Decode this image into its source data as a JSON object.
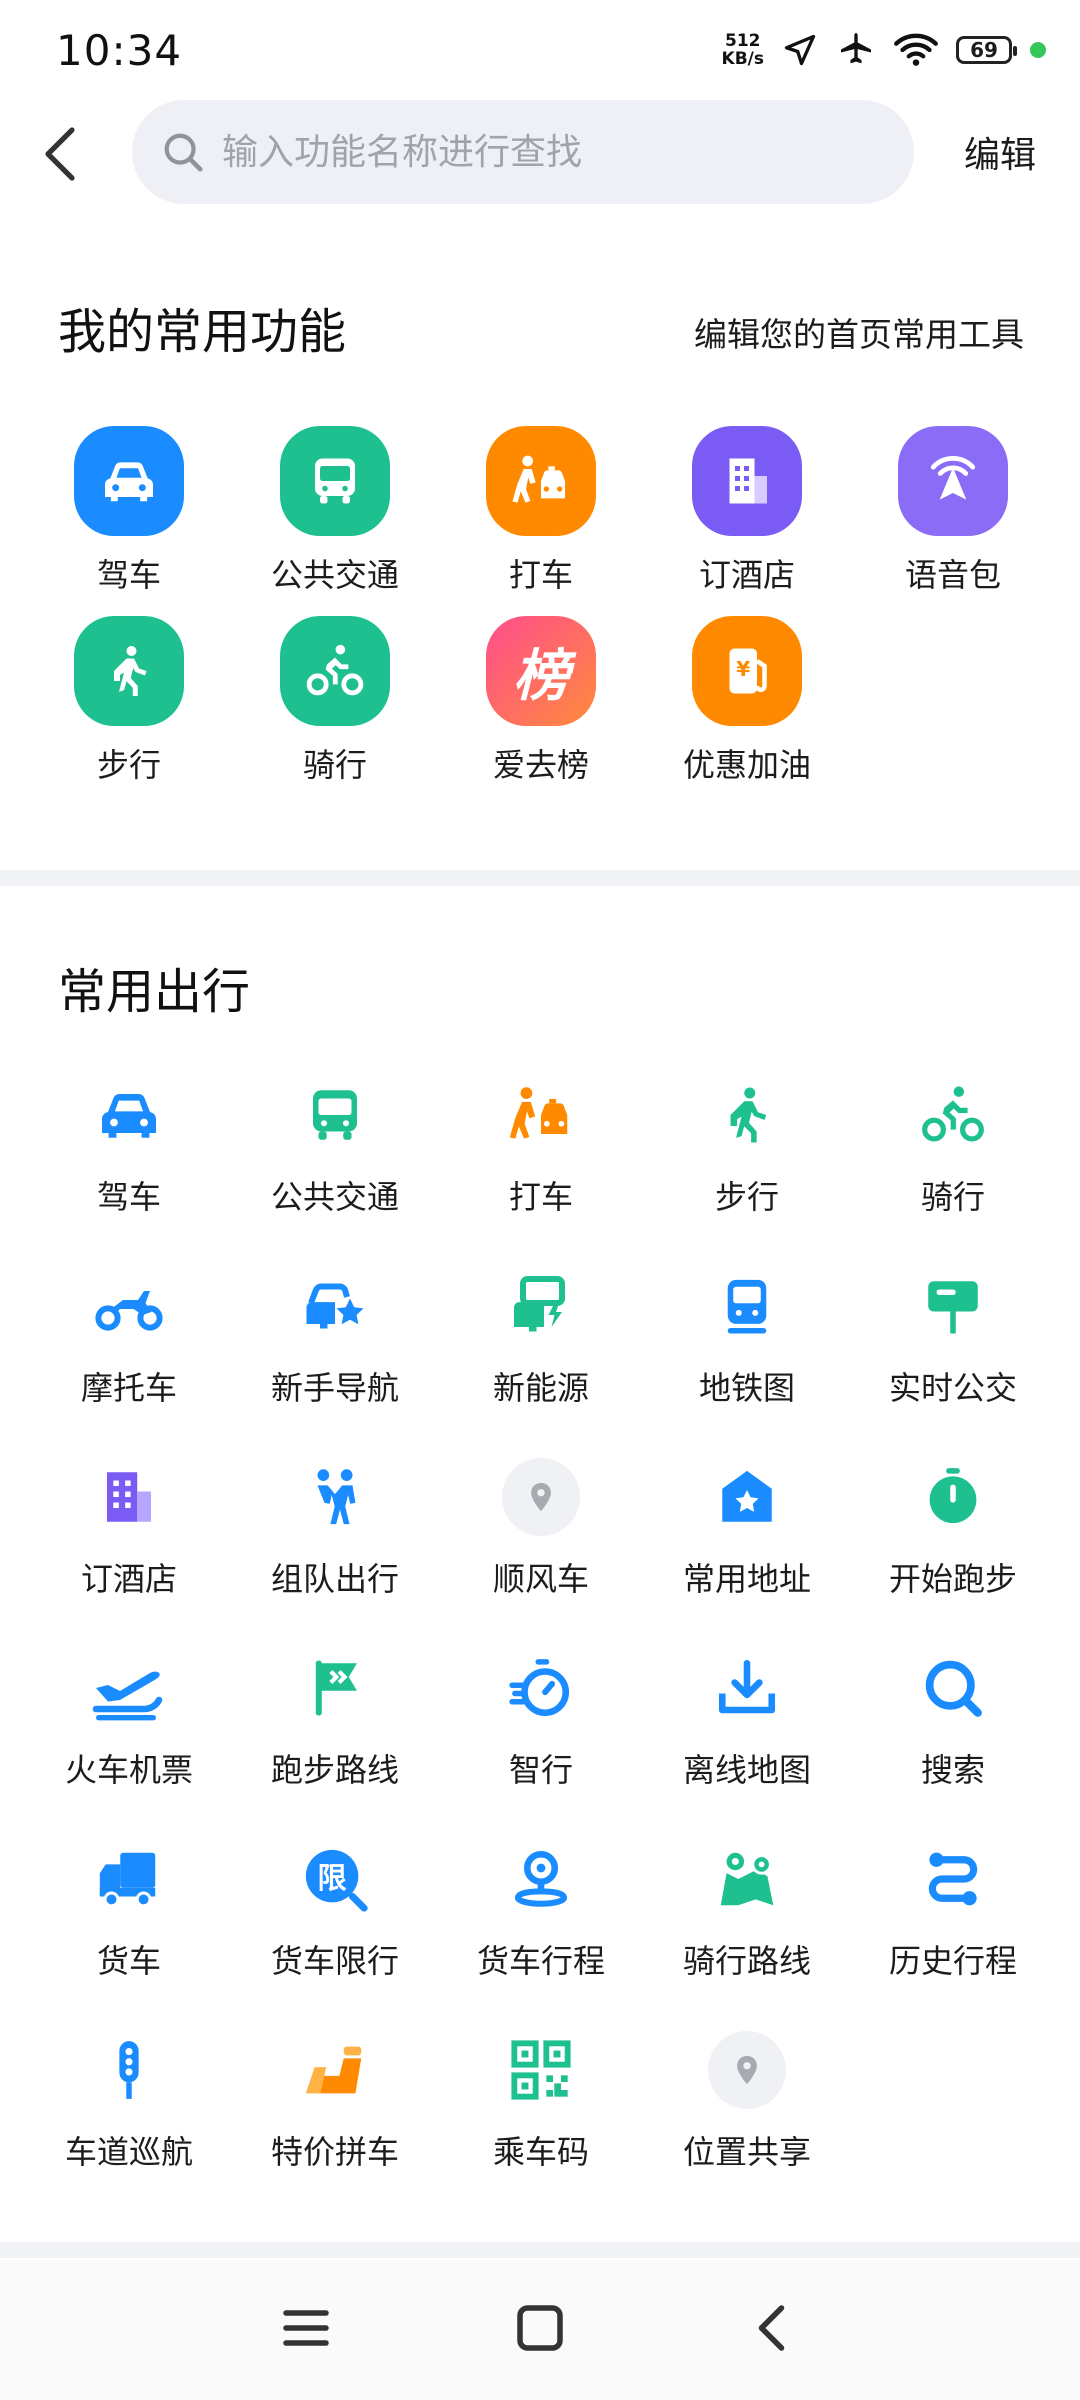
{
  "status": {
    "time": "10:34",
    "net_speed_value": "512",
    "net_speed_unit": "KB/s",
    "battery": "69"
  },
  "header": {
    "search_placeholder": "输入功能名称进行查找",
    "edit": "编辑"
  },
  "favorites": {
    "title": "我的常用功能",
    "subtitle": "编辑您的首页常用工具",
    "items": [
      {
        "label": "驾车",
        "icon": "car-icon",
        "color": "#1a8cff"
      },
      {
        "label": "公共交通",
        "icon": "bus-icon",
        "color": "#1fc08f"
      },
      {
        "label": "打车",
        "icon": "taxi-icon",
        "color": "#ff8a00"
      },
      {
        "label": "订酒店",
        "icon": "hotel-icon",
        "color": "#7a5cf5"
      },
      {
        "label": "语音包",
        "icon": "voice-pack-icon",
        "color": "#8a6cf7"
      },
      {
        "label": "步行",
        "icon": "walk-icon",
        "color": "#1fc08f"
      },
      {
        "label": "骑行",
        "icon": "bike-icon",
        "color": "#1fc08f"
      },
      {
        "label": "爱去榜",
        "icon": "ranking-icon",
        "color": "#ff5a7a"
      },
      {
        "label": "优惠加油",
        "icon": "fuel-icon",
        "color": "#ff8a00"
      }
    ]
  },
  "travel": {
    "title": "常用出行",
    "items": [
      {
        "label": "驾车",
        "icon": "car-icon"
      },
      {
        "label": "公共交通",
        "icon": "bus-icon"
      },
      {
        "label": "打车",
        "icon": "taxi-icon"
      },
      {
        "label": "步行",
        "icon": "walk-icon"
      },
      {
        "label": "骑行",
        "icon": "bike-icon"
      },
      {
        "label": "摩托车",
        "icon": "motorcycle-icon"
      },
      {
        "label": "新手导航",
        "icon": "novice-nav-icon"
      },
      {
        "label": "新能源",
        "icon": "ev-icon"
      },
      {
        "label": "地铁图",
        "icon": "subway-icon"
      },
      {
        "label": "实时公交",
        "icon": "realtime-bus-icon"
      },
      {
        "label": "订酒店",
        "icon": "hotel-icon"
      },
      {
        "label": "组队出行",
        "icon": "team-travel-icon"
      },
      {
        "label": "顺风车",
        "icon": "carpool-icon"
      },
      {
        "label": "常用地址",
        "icon": "home-address-icon"
      },
      {
        "label": "开始跑步",
        "icon": "stopwatch-icon"
      },
      {
        "label": "火车机票",
        "icon": "train-plane-icon"
      },
      {
        "label": "跑步路线",
        "icon": "running-route-icon"
      },
      {
        "label": "智行",
        "icon": "smart-travel-icon"
      },
      {
        "label": "离线地图",
        "icon": "offline-map-icon"
      },
      {
        "label": "搜索",
        "icon": "search-icon"
      },
      {
        "label": "货车",
        "icon": "truck-icon"
      },
      {
        "label": "货车限行",
        "icon": "truck-restriction-icon"
      },
      {
        "label": "货车行程",
        "icon": "truck-trip-icon"
      },
      {
        "label": "骑行路线",
        "icon": "cycling-route-icon"
      },
      {
        "label": "历史行程",
        "icon": "history-trip-icon"
      },
      {
        "label": "车道巡航",
        "icon": "lane-cruise-icon"
      },
      {
        "label": "特价拼车",
        "icon": "discount-carpool-icon"
      },
      {
        "label": "乘车码",
        "icon": "ride-code-icon"
      },
      {
        "label": "位置共享",
        "icon": "location-share-icon"
      }
    ]
  },
  "colors": {
    "blue": "#1a8cff",
    "green": "#1fc08f",
    "orange": "#ff8a00",
    "purple": "#7a5cf5",
    "gray": "#9a9da3"
  }
}
